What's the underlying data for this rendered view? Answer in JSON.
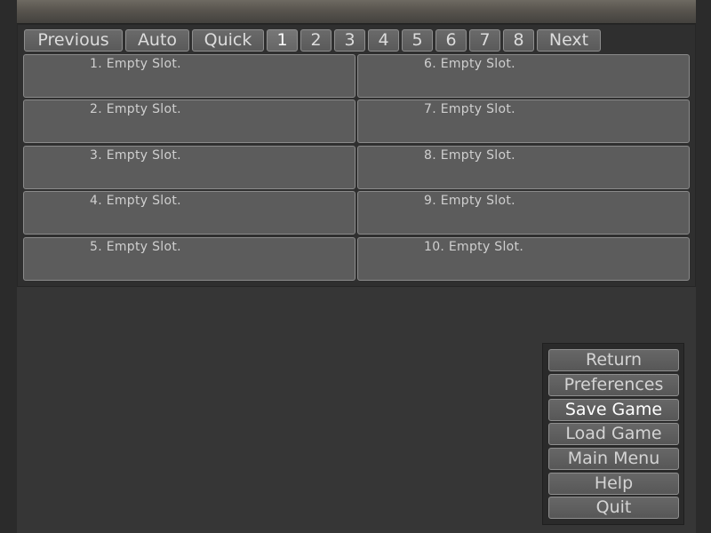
{
  "nav": {
    "previous": "Previous",
    "auto": "Auto",
    "quick": "Quick",
    "pages": [
      "1",
      "2",
      "3",
      "4",
      "5",
      "6",
      "7",
      "8"
    ],
    "next": "Next",
    "selected_page": "1"
  },
  "slots": [
    "1. Empty Slot.",
    "2. Empty Slot.",
    "3. Empty Slot.",
    "4. Empty Slot.",
    "5. Empty Slot.",
    "6. Empty Slot.",
    "7. Empty Slot.",
    "8. Empty Slot.",
    "9. Empty Slot.",
    "10. Empty Slot."
  ],
  "menu": {
    "return": "Return",
    "preferences": "Preferences",
    "save_game": "Save Game",
    "load_game": "Load Game",
    "main_menu": "Main Menu",
    "help": "Help",
    "quit": "Quit",
    "selected": "Save Game"
  }
}
